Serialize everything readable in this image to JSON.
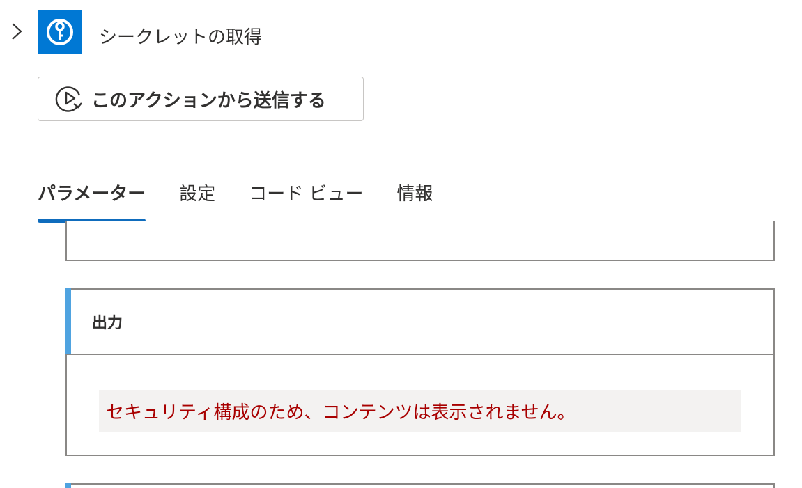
{
  "header": {
    "expand_icon": "chevron-right-icon",
    "app_icon": "key-vault-icon",
    "title": "シークレットの取得"
  },
  "run_button": {
    "icon": "play-from-here-icon",
    "label": "このアクションから送信する"
  },
  "tabs": [
    {
      "label": "パラメーター",
      "active": true
    },
    {
      "label": "設定",
      "active": false
    },
    {
      "label": "コード ビュー",
      "active": false
    },
    {
      "label": "情報",
      "active": false
    }
  ],
  "output_section": {
    "title": "出力",
    "secure_message": "セキュリティ構成のため、コンテンツは表示されません。"
  },
  "colors": {
    "accent": "#0078d4",
    "tab_indicator": "#0f6cbd",
    "card_accent": "#4fa3e0",
    "secure_text": "#a80000"
  }
}
